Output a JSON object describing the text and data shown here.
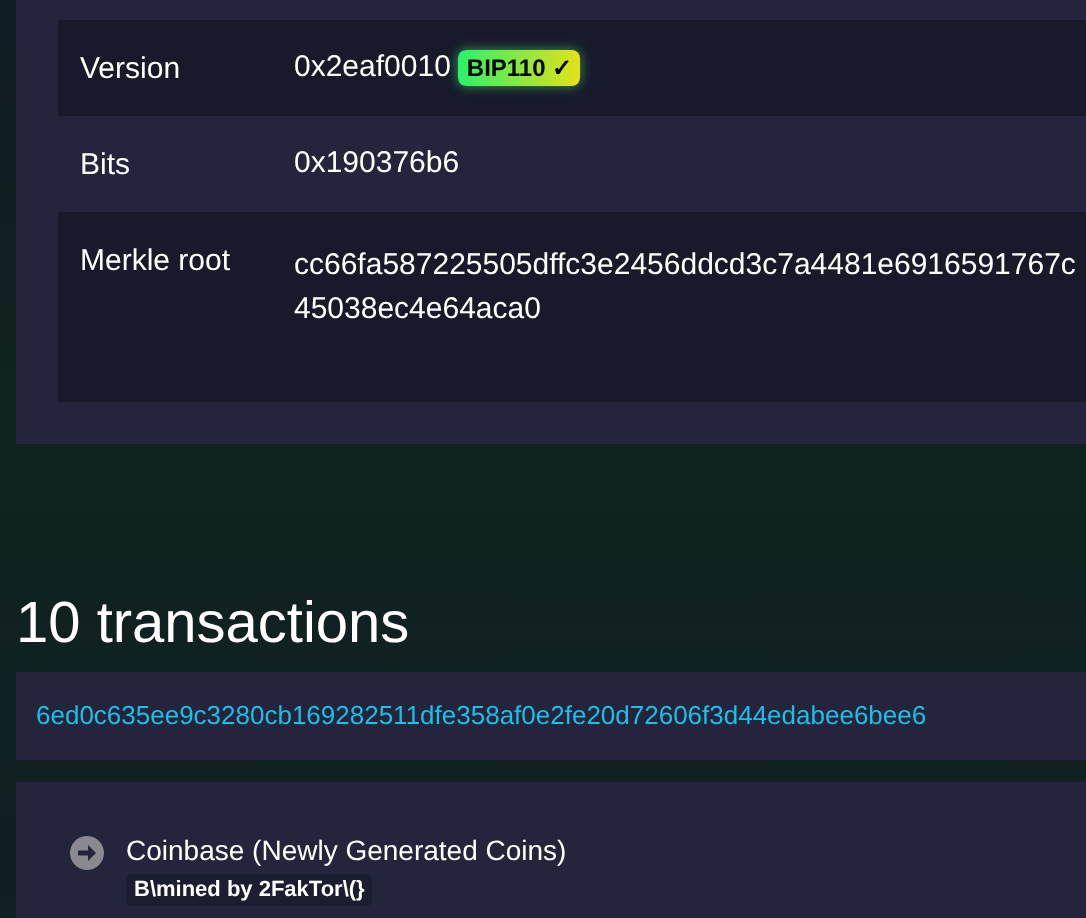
{
  "header_rows": [
    {
      "label": "Version",
      "value": "0x2eaf0010",
      "badge": "BIP110 ✓"
    },
    {
      "label": "Bits",
      "value": "0x190376b6"
    },
    {
      "label": "Merkle root",
      "value": "cc66fa587225505dffc3e2456ddcd3c7a4481e6916591767c45038ec4e64aca0"
    }
  ],
  "transactions_heading": "10 transactions",
  "transaction": {
    "txid": "6ed0c635ee9c3280cb169282511dfe358af0e2fe20d72606f3d44edabee6bee6",
    "inputs": [
      {
        "label": "Coinbase (Newly Generated Coins)",
        "script": "B\\mined by 2FakTor\\(}"
      }
    ]
  }
}
